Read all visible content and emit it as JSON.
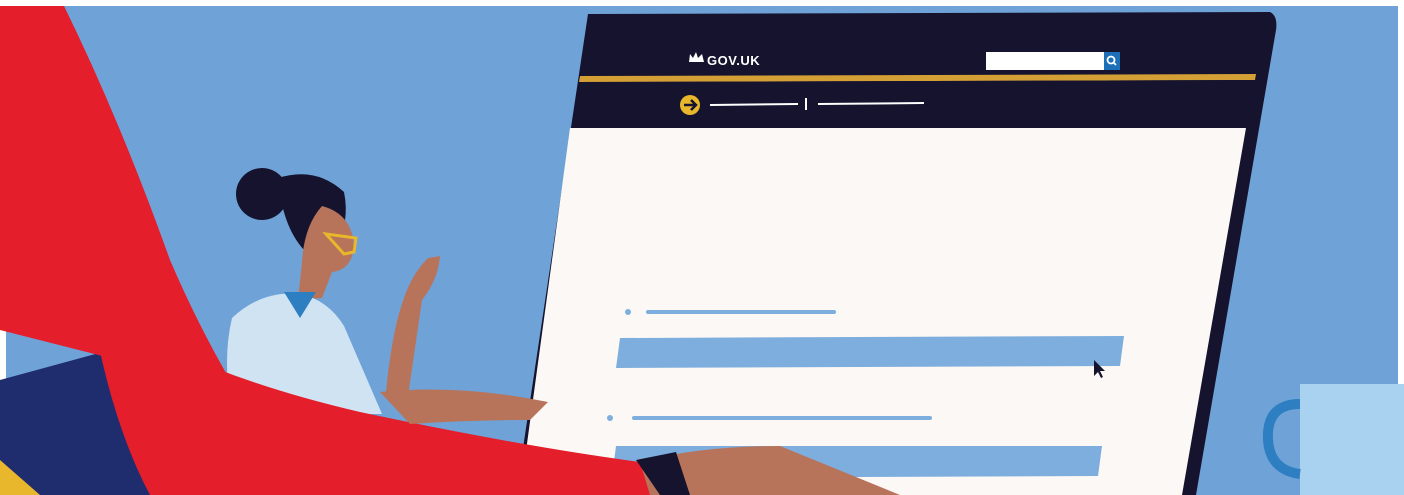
{
  "header": {
    "brand_text": "GOV.UK",
    "crown_icon": "crown-icon",
    "search_icon": "search-icon",
    "search_placeholder": ""
  },
  "subheader": {
    "arrow_icon": "arrow-right-circle-icon"
  },
  "colors": {
    "sky": "#6fa3d8",
    "frame": "#ffffff",
    "header_bg": "#15132d",
    "gold_rule": "#d4a035",
    "page_bg": "#fcf8f5",
    "content_bar": "#7eaedd",
    "red_chair": "#e41e2a",
    "navy": "#1f2d6e",
    "skin": "#b8745a",
    "shirt": "#cfe3f3",
    "mug": "#a9d2f1",
    "mug_handle": "#2e7fc1"
  }
}
